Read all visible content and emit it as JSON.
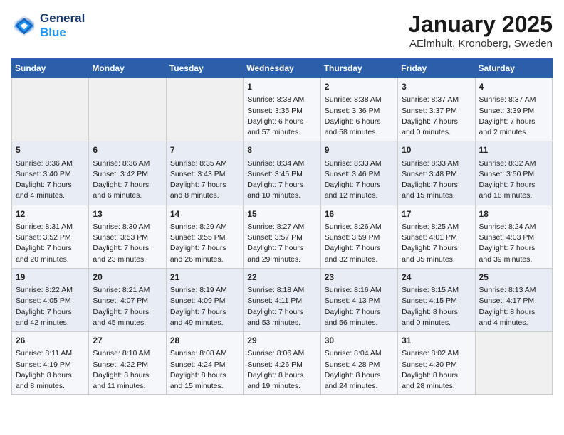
{
  "header": {
    "logo_line1": "General",
    "logo_line2": "Blue",
    "title": "January 2025",
    "subtitle": "AElmhult, Kronoberg, Sweden"
  },
  "columns": [
    "Sunday",
    "Monday",
    "Tuesday",
    "Wednesday",
    "Thursday",
    "Friday",
    "Saturday"
  ],
  "weeks": [
    [
      {
        "day": "",
        "info": ""
      },
      {
        "day": "",
        "info": ""
      },
      {
        "day": "",
        "info": ""
      },
      {
        "day": "1",
        "info": "Sunrise: 8:38 AM\nSunset: 3:35 PM\nDaylight: 6 hours\nand 57 minutes."
      },
      {
        "day": "2",
        "info": "Sunrise: 8:38 AM\nSunset: 3:36 PM\nDaylight: 6 hours\nand 58 minutes."
      },
      {
        "day": "3",
        "info": "Sunrise: 8:37 AM\nSunset: 3:37 PM\nDaylight: 7 hours\nand 0 minutes."
      },
      {
        "day": "4",
        "info": "Sunrise: 8:37 AM\nSunset: 3:39 PM\nDaylight: 7 hours\nand 2 minutes."
      }
    ],
    [
      {
        "day": "5",
        "info": "Sunrise: 8:36 AM\nSunset: 3:40 PM\nDaylight: 7 hours\nand 4 minutes."
      },
      {
        "day": "6",
        "info": "Sunrise: 8:36 AM\nSunset: 3:42 PM\nDaylight: 7 hours\nand 6 minutes."
      },
      {
        "day": "7",
        "info": "Sunrise: 8:35 AM\nSunset: 3:43 PM\nDaylight: 7 hours\nand 8 minutes."
      },
      {
        "day": "8",
        "info": "Sunrise: 8:34 AM\nSunset: 3:45 PM\nDaylight: 7 hours\nand 10 minutes."
      },
      {
        "day": "9",
        "info": "Sunrise: 8:33 AM\nSunset: 3:46 PM\nDaylight: 7 hours\nand 12 minutes."
      },
      {
        "day": "10",
        "info": "Sunrise: 8:33 AM\nSunset: 3:48 PM\nDaylight: 7 hours\nand 15 minutes."
      },
      {
        "day": "11",
        "info": "Sunrise: 8:32 AM\nSunset: 3:50 PM\nDaylight: 7 hours\nand 18 minutes."
      }
    ],
    [
      {
        "day": "12",
        "info": "Sunrise: 8:31 AM\nSunset: 3:52 PM\nDaylight: 7 hours\nand 20 minutes."
      },
      {
        "day": "13",
        "info": "Sunrise: 8:30 AM\nSunset: 3:53 PM\nDaylight: 7 hours\nand 23 minutes."
      },
      {
        "day": "14",
        "info": "Sunrise: 8:29 AM\nSunset: 3:55 PM\nDaylight: 7 hours\nand 26 minutes."
      },
      {
        "day": "15",
        "info": "Sunrise: 8:27 AM\nSunset: 3:57 PM\nDaylight: 7 hours\nand 29 minutes."
      },
      {
        "day": "16",
        "info": "Sunrise: 8:26 AM\nSunset: 3:59 PM\nDaylight: 7 hours\nand 32 minutes."
      },
      {
        "day": "17",
        "info": "Sunrise: 8:25 AM\nSunset: 4:01 PM\nDaylight: 7 hours\nand 35 minutes."
      },
      {
        "day": "18",
        "info": "Sunrise: 8:24 AM\nSunset: 4:03 PM\nDaylight: 7 hours\nand 39 minutes."
      }
    ],
    [
      {
        "day": "19",
        "info": "Sunrise: 8:22 AM\nSunset: 4:05 PM\nDaylight: 7 hours\nand 42 minutes."
      },
      {
        "day": "20",
        "info": "Sunrise: 8:21 AM\nSunset: 4:07 PM\nDaylight: 7 hours\nand 45 minutes."
      },
      {
        "day": "21",
        "info": "Sunrise: 8:19 AM\nSunset: 4:09 PM\nDaylight: 7 hours\nand 49 minutes."
      },
      {
        "day": "22",
        "info": "Sunrise: 8:18 AM\nSunset: 4:11 PM\nDaylight: 7 hours\nand 53 minutes."
      },
      {
        "day": "23",
        "info": "Sunrise: 8:16 AM\nSunset: 4:13 PM\nDaylight: 7 hours\nand 56 minutes."
      },
      {
        "day": "24",
        "info": "Sunrise: 8:15 AM\nSunset: 4:15 PM\nDaylight: 8 hours\nand 0 minutes."
      },
      {
        "day": "25",
        "info": "Sunrise: 8:13 AM\nSunset: 4:17 PM\nDaylight: 8 hours\nand 4 minutes."
      }
    ],
    [
      {
        "day": "26",
        "info": "Sunrise: 8:11 AM\nSunset: 4:19 PM\nDaylight: 8 hours\nand 8 minutes."
      },
      {
        "day": "27",
        "info": "Sunrise: 8:10 AM\nSunset: 4:22 PM\nDaylight: 8 hours\nand 11 minutes."
      },
      {
        "day": "28",
        "info": "Sunrise: 8:08 AM\nSunset: 4:24 PM\nDaylight: 8 hours\nand 15 minutes."
      },
      {
        "day": "29",
        "info": "Sunrise: 8:06 AM\nSunset: 4:26 PM\nDaylight: 8 hours\nand 19 minutes."
      },
      {
        "day": "30",
        "info": "Sunrise: 8:04 AM\nSunset: 4:28 PM\nDaylight: 8 hours\nand 24 minutes."
      },
      {
        "day": "31",
        "info": "Sunrise: 8:02 AM\nSunset: 4:30 PM\nDaylight: 8 hours\nand 28 minutes."
      },
      {
        "day": "",
        "info": ""
      }
    ]
  ]
}
